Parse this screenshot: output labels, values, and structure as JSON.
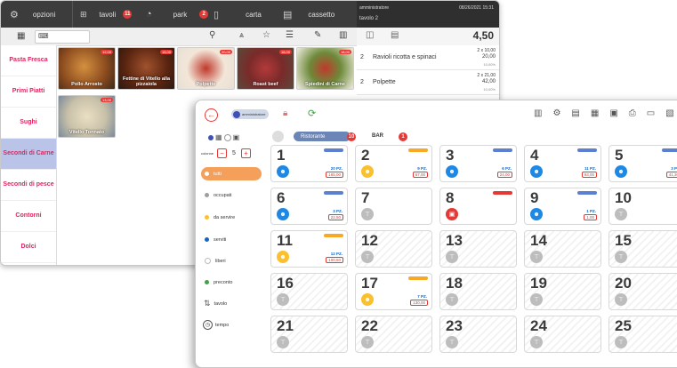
{
  "back": {
    "topbar": {
      "items": [
        {
          "label": "opzioni",
          "icon": "gear-icon"
        },
        {
          "label": "tavoli",
          "icon": "table-icon",
          "badge": "11"
        },
        {
          "label": "park",
          "icon": "clock-icon",
          "badge": "2"
        },
        {
          "label": "carta",
          "icon": "card-icon"
        },
        {
          "label": "cassetto",
          "icon": "drawer-icon"
        }
      ]
    },
    "right_header": {
      "user": "amministratore",
      "date": "08/26/2021 15:31",
      "table": "tavolo 2"
    },
    "total": "4,50",
    "categories": [
      "Pasta Fresca",
      "Primi Piatti",
      "Sughi",
      "Secondi di Carne",
      "Secondi di pesce",
      "Contorni",
      "Dolci"
    ],
    "selected_category": "Secondi di Carne",
    "products": [
      {
        "name": "Pollo Arrosto",
        "price": "12,00"
      },
      {
        "name": "Fettine di Vitello alla pizzaiola",
        "price": "15,00"
      },
      {
        "name": "Polpette",
        "price": "20,00"
      },
      {
        "name": "Roast beef",
        "price": "16,00"
      },
      {
        "name": "Spiedini di Carne",
        "price": "18,00"
      },
      {
        "name": "Vitello Tonnato",
        "price": "13,00"
      }
    ],
    "orders": [
      {
        "qty": "2",
        "name": "Ravioli ricotta e spinaci",
        "detail": "2 x 10,00",
        "price": "20,00",
        "tax": "10,00%"
      },
      {
        "qty": "2",
        "name": "Polpette",
        "detail": "2 x 21,00",
        "price": "42,00",
        "tax": "10,00%"
      }
    ]
  },
  "front": {
    "user_chip": "amministratore",
    "columns_label": "colonne",
    "columns_value": "5",
    "minus": "−",
    "plus": "+",
    "filters": [
      {
        "label": "tutti",
        "color": "#ffffff"
      },
      {
        "label": "occupati",
        "color": "#9e9e9e"
      },
      {
        "label": "da servire",
        "color": "#fbc02d"
      },
      {
        "label": "serviti",
        "color": "#1565c0"
      },
      {
        "label": "liberi",
        "color": "#ffffff"
      },
      {
        "label": "preconto",
        "color": "#43a047"
      },
      {
        "label": "tavolo",
        "color": ""
      },
      {
        "label": "tempo",
        "color": ""
      }
    ],
    "tabs": [
      {
        "label": "Ristorante",
        "badge": "10"
      },
      {
        "label": "BAR",
        "badge": "1"
      }
    ],
    "tables": [
      {
        "num": "1",
        "state": "served",
        "info": "20 PZ.",
        "amount": "165,00"
      },
      {
        "num": "2",
        "state": "toserve",
        "info": "9 PZ.",
        "amount": "67,00"
      },
      {
        "num": "3",
        "state": "served",
        "info": "6 PZ.",
        "amount": "24,00"
      },
      {
        "num": "4",
        "state": "served",
        "info": "11 PZ.",
        "amount": "93,00"
      },
      {
        "num": "5",
        "state": "served",
        "info": "3 PZ.",
        "amount": "41,30"
      },
      {
        "num": "6",
        "state": "served",
        "info": "3 PZ.",
        "amount": "22,50"
      },
      {
        "num": "7",
        "state": "free",
        "info": "",
        "amount": ""
      },
      {
        "num": "8",
        "state": "alert",
        "info": "",
        "amount": ""
      },
      {
        "num": "9",
        "state": "served",
        "info": "1 PZ.",
        "amount": "1,00"
      },
      {
        "num": "10",
        "state": "free",
        "info": "",
        "amount": ""
      },
      {
        "num": "11",
        "state": "toserve",
        "info": "12 PZ.",
        "amount": "100,50"
      },
      {
        "num": "12",
        "state": "free",
        "info": "",
        "amount": ""
      },
      {
        "num": "13",
        "state": "free",
        "info": "",
        "amount": ""
      },
      {
        "num": "14",
        "state": "free",
        "info": "",
        "amount": ""
      },
      {
        "num": "15",
        "state": "free",
        "info": "",
        "amount": ""
      },
      {
        "num": "16",
        "state": "free",
        "info": "",
        "amount": ""
      },
      {
        "num": "17",
        "state": "toserve",
        "info": "7 PZ.",
        "amount": "130,00"
      },
      {
        "num": "18",
        "state": "free",
        "info": "",
        "amount": ""
      },
      {
        "num": "19",
        "state": "free",
        "info": "",
        "amount": ""
      },
      {
        "num": "20",
        "state": "free",
        "info": "",
        "amount": ""
      },
      {
        "num": "21",
        "state": "free",
        "info": "",
        "amount": ""
      },
      {
        "num": "22",
        "state": "free",
        "info": "",
        "amount": ""
      },
      {
        "num": "23",
        "state": "free",
        "info": "",
        "amount": ""
      },
      {
        "num": "24",
        "state": "free",
        "info": "",
        "amount": ""
      },
      {
        "num": "25",
        "state": "free",
        "info": "",
        "amount": ""
      }
    ]
  },
  "colors": {
    "accent": "#e0245e",
    "served": "#1e88e5",
    "toserve": "#fbc02d",
    "alert": "#e53935",
    "free": "#bdbdbd",
    "preconto": "#43a047"
  }
}
